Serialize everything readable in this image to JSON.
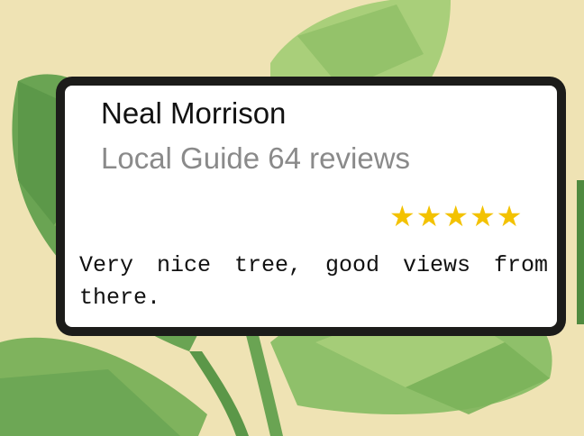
{
  "review": {
    "name": "Neal Morrison",
    "meta": "Local Guide 64 reviews",
    "stars": "★★★★★",
    "rating": 5,
    "text": "Very nice tree, good views from there."
  },
  "colors": {
    "background": "#efe3b4",
    "leaf_dark": "#5f9e4d",
    "leaf_light": "#a9cf7a",
    "star": "#f3c200",
    "card_border": "#1c1c1a"
  }
}
